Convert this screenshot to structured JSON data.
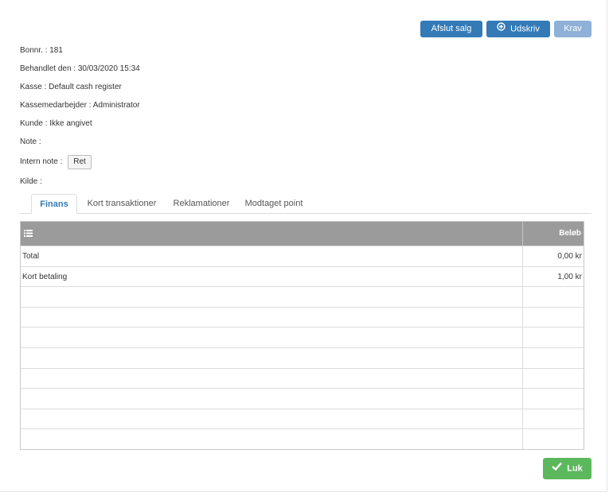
{
  "toolbar": {
    "complete_sale_label": "Afslut salg",
    "print_label": "Udskriv",
    "claim_label": "Krav"
  },
  "receipt": {
    "receipt_no": "Bonnr. : 181",
    "processed": "Behandlet den : 30/03/2020 15:34",
    "register": "Kasse : Default cash register",
    "employee": "Kassemedarbejder : Administrator",
    "customer": "Kunde : Ikke angivet",
    "note": "Note :",
    "internal_note": "Intern note :",
    "internal_note_edit_label": "Ret",
    "source": "Kilde :"
  },
  "tabs": [
    {
      "label": "Finans",
      "active": true
    },
    {
      "label": "Kort transaktioner",
      "active": false
    },
    {
      "label": "Reklamationer",
      "active": false
    },
    {
      "label": "Modtaget point",
      "active": false
    }
  ],
  "grid": {
    "amount_header": "Beløb",
    "rows": [
      {
        "name": "Total",
        "amount": "0,00 kr"
      },
      {
        "name": "Kort betaling",
        "amount": "1,00 kr"
      },
      {
        "name": "",
        "amount": ""
      },
      {
        "name": "",
        "amount": ""
      },
      {
        "name": "",
        "amount": ""
      },
      {
        "name": "",
        "amount": ""
      },
      {
        "name": "",
        "amount": ""
      },
      {
        "name": "",
        "amount": ""
      },
      {
        "name": "",
        "amount": ""
      },
      {
        "name": "",
        "amount": ""
      }
    ]
  },
  "footer": {
    "close_label": "Luk"
  },
  "colors": {
    "primary": "#337ab7",
    "disabled": "#8fb1d8",
    "success": "#5cb85c",
    "grid_header": "#9b9b9b"
  },
  "icons": {
    "print": "plus-circle-icon",
    "grid_menu": "list-icon",
    "close": "check-icon"
  }
}
